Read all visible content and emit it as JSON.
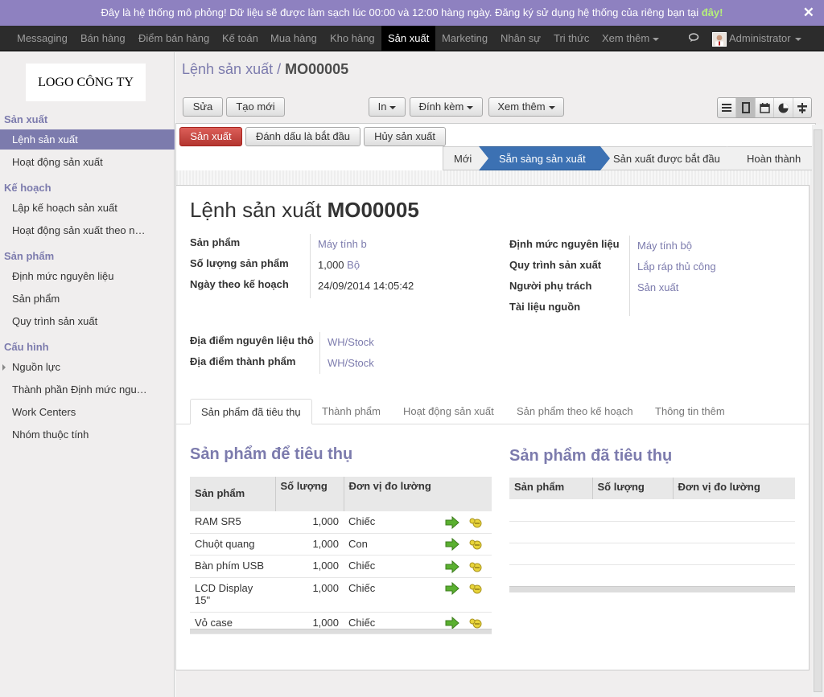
{
  "demo_bar": {
    "text": "Đây là hệ thống mô phỏng! Dữ liệu sẽ được làm sạch lúc 00:00 và 12:00 hàng ngày. Đăng ký sử dụng hệ thống của riêng bạn tại",
    "link": "đây!",
    "close": "✕"
  },
  "topnav": {
    "items": [
      "Messaging",
      "Bán hàng",
      "Điểm bán hàng",
      "Kế toán",
      "Mua hàng",
      "Kho hàng",
      "Sản xuất",
      "Marketing",
      "Nhân sự",
      "Tri thức",
      "Xem thêm"
    ],
    "active": "Sản xuất",
    "user": "Administrator"
  },
  "sidebar": {
    "logo": "LOGO CÔNG TY",
    "sections": [
      {
        "title": "Sản xuất",
        "items": [
          "Lệnh sản xuất",
          "Hoạt động sản xuất"
        ]
      },
      {
        "title": "Kế hoạch",
        "items": [
          "Lập kế hoạch sản xuất",
          "Hoạt động sản xuất theo n…"
        ]
      },
      {
        "title": "Sản phẩm",
        "items": [
          "Định mức nguyên liệu",
          "Sản phẩm",
          "Quy trình sản xuất"
        ]
      },
      {
        "title": "Cấu hình",
        "items": [
          "Nguồn lực",
          "Thành phần Định mức ngu…",
          "Work Centers",
          "Nhóm thuộc tính"
        ]
      }
    ],
    "active_item": "Lệnh sản xuất"
  },
  "breadcrumb": {
    "parent": "Lệnh sản xuất",
    "separator": " / ",
    "current": "MO00005"
  },
  "toolbar": {
    "edit": "Sửa",
    "create": "Tạo mới",
    "print": "In",
    "attach": "Đính kèm",
    "more": "Xem thêm"
  },
  "actions": {
    "produce": "Sản xuất",
    "mark_start": "Đánh dấu là bắt đầu",
    "cancel": "Hủy sản xuất"
  },
  "stages": [
    "Mới",
    "Sẵn sàng sản xuất",
    "Sản xuất được bắt đầu",
    "Hoàn thành"
  ],
  "active_stage": "Sẵn sàng sản xuất",
  "form": {
    "title_prefix": "Lệnh sản xuất",
    "title_ref": "MO00005",
    "left": [
      {
        "label": "Sản phẩm",
        "value": "Máy tính b"
      },
      {
        "label": "Số lượng sản phẩm",
        "value": "1,000",
        "unit": "Bộ"
      },
      {
        "label": "Ngày theo kế hoạch",
        "value": "24/09/2014 14:05:42"
      }
    ],
    "right": [
      {
        "label": "Định mức nguyên liệu",
        "value": "Máy tính bộ"
      },
      {
        "label": "Quy trình sản xuất",
        "value": "Lắp ráp thủ công"
      },
      {
        "label": "Người phụ trách",
        "value": "Sản xuất"
      },
      {
        "label": "Tài liệu nguồn",
        "value": ""
      }
    ],
    "locations": [
      {
        "label": "Địa điểm nguyên liệu thô",
        "value": "WH/Stock"
      },
      {
        "label": "Địa điểm thành phẩm",
        "value": "WH/Stock"
      }
    ]
  },
  "tabs": [
    "Sản phẩm đã tiêu thụ",
    "Thành phẩm",
    "Hoạt động sản xuất",
    "Sản phẩm theo kế hoạch",
    "Thông tin thêm"
  ],
  "active_tab": "Sản phẩm đã tiêu thụ",
  "to_consume": {
    "heading": "Sản phẩm để tiêu thụ",
    "columns": [
      "Sản phẩm",
      "Số lượng",
      "Đơn vị đo lường"
    ],
    "rows": [
      {
        "product": "RAM SR5",
        "qty": "1,000",
        "uom": "Chiếc"
      },
      {
        "product": "Chuột quang",
        "qty": "1,000",
        "uom": "Con"
      },
      {
        "product": "Bàn phím USB",
        "qty": "1,000",
        "uom": "Chiếc"
      },
      {
        "product": "LCD Display 15\"",
        "qty": "1,000",
        "uom": "Chiếc"
      },
      {
        "product": "Vỏ case",
        "qty": "1,000",
        "uom": "Chiếc"
      }
    ]
  },
  "consumed": {
    "heading": "Sản phẩm đã tiêu thụ",
    "columns": [
      "Sản phẩm",
      "Số lượng",
      "Đơn vị đo lường"
    ]
  },
  "colors": {
    "accent": "#7c7bad",
    "demo_bar": "#8e81c0",
    "primary": "#3c71b3",
    "danger": "#c9413b"
  }
}
